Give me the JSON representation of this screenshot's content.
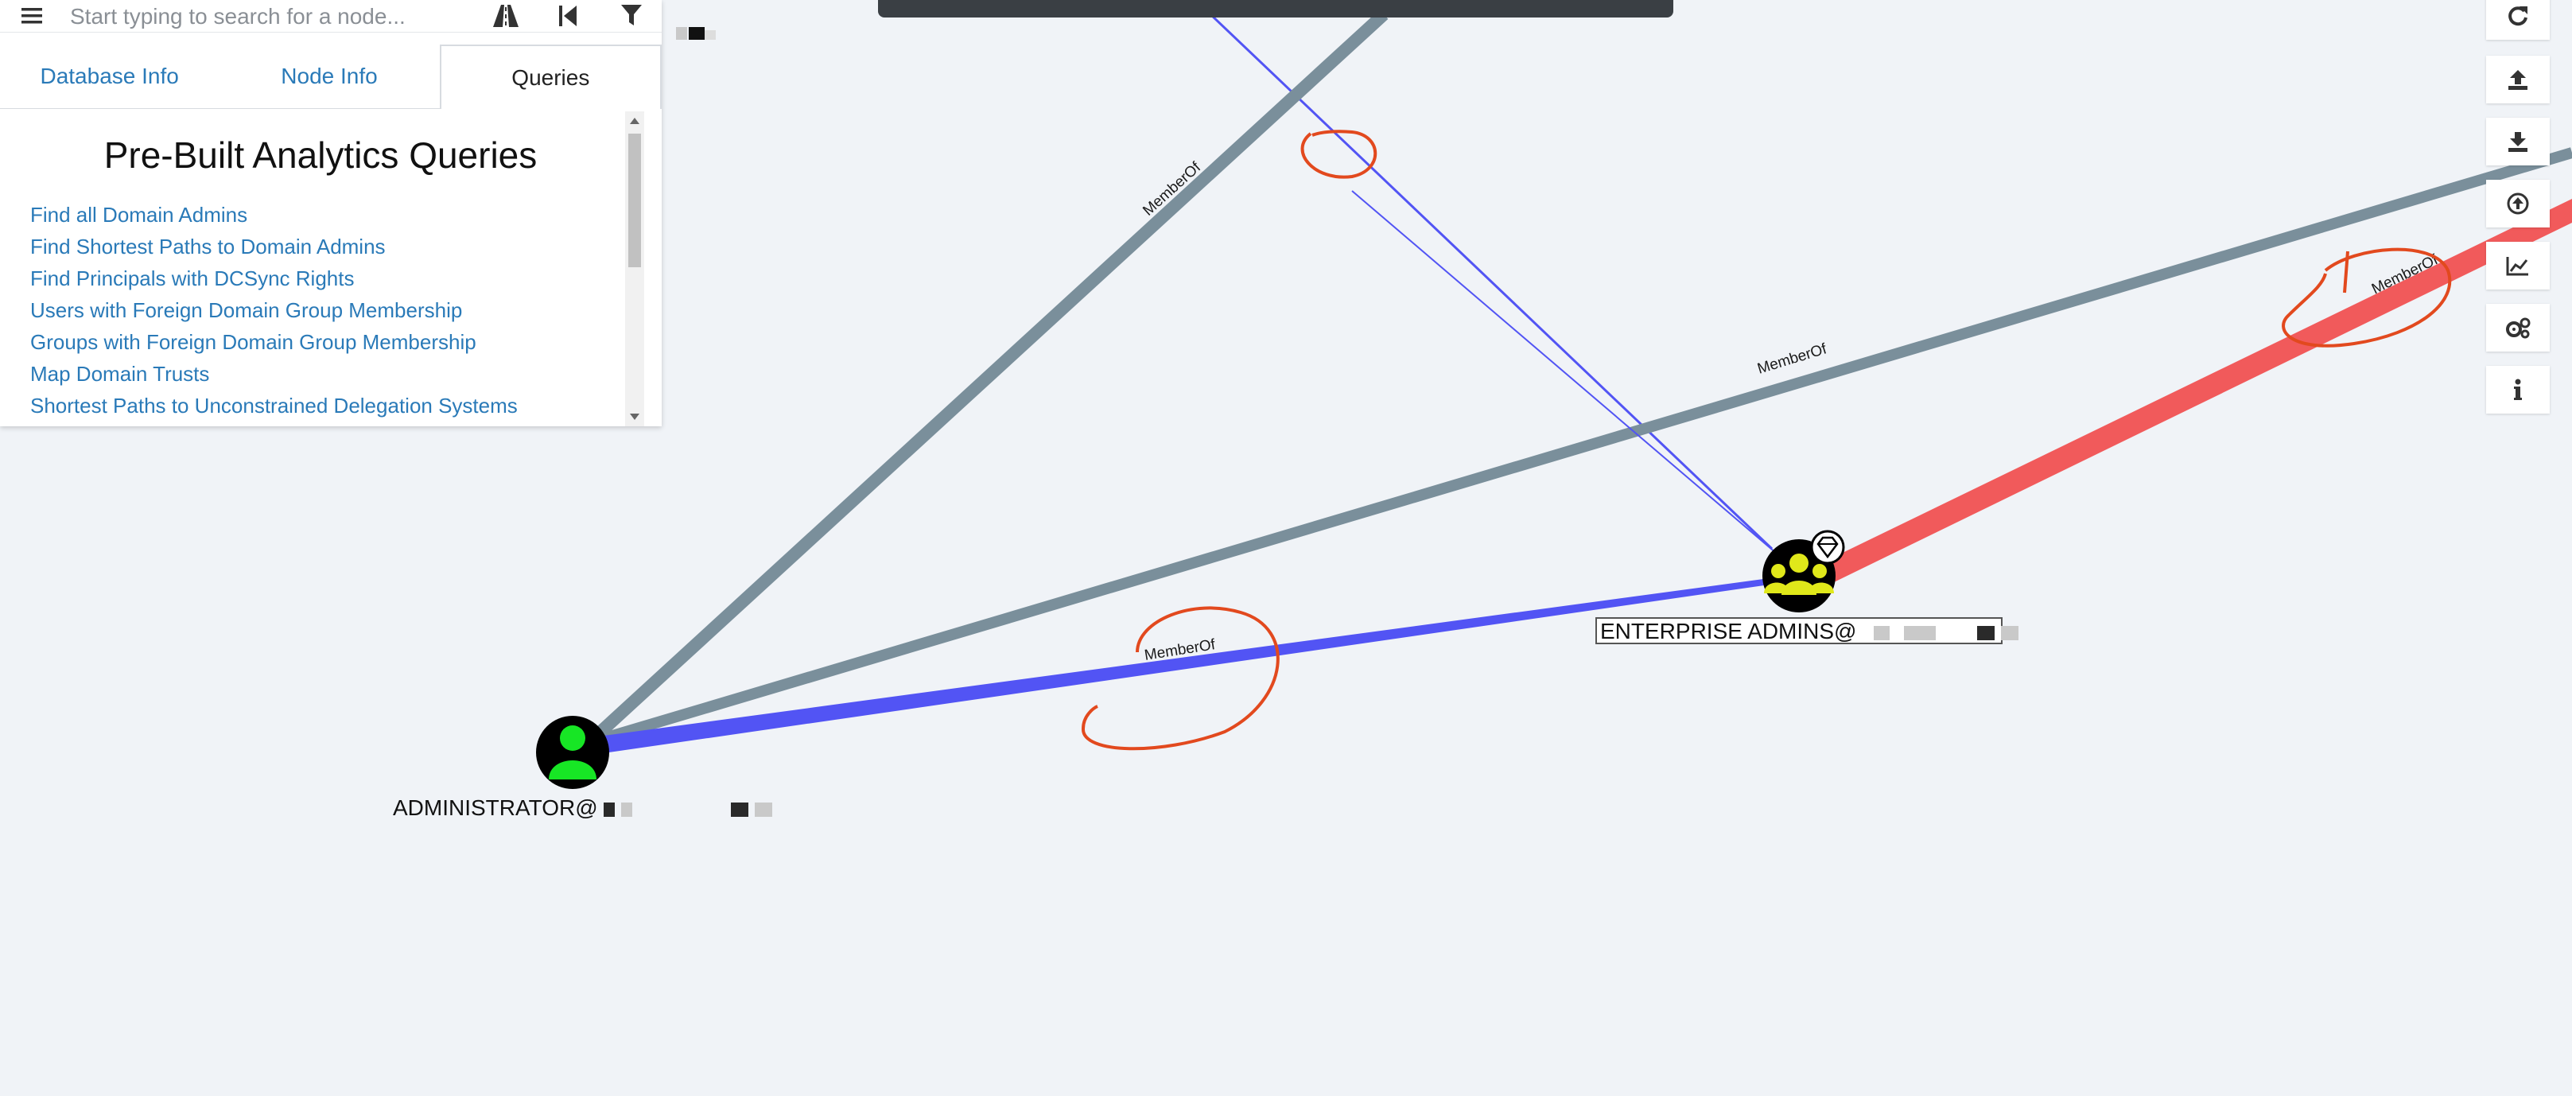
{
  "search": {
    "placeholder": "Start typing to search for a node..."
  },
  "tabs": [
    {
      "label": "Database Info",
      "active": false
    },
    {
      "label": "Node Info",
      "active": false
    },
    {
      "label": "Queries",
      "active": true
    }
  ],
  "queries": {
    "title": "Pre-Built Analytics Queries",
    "items": [
      "Find all Domain Admins",
      "Find Shortest Paths to Domain Admins",
      "Find Principals with DCSync Rights",
      "Users with Foreign Domain Group Membership",
      "Groups with Foreign Domain Group Membership",
      "Map Domain Trusts",
      "Shortest Paths to Unconstrained Delegation Systems"
    ]
  },
  "graph": {
    "edges": [
      {
        "label": "MemberOf"
      },
      {
        "label": "MemberOf"
      },
      {
        "label": "MemberOf"
      },
      {
        "label": "MemberOf"
      }
    ],
    "nodes": [
      {
        "label": "ENTERPRISE ADMINS@",
        "kind": "group"
      },
      {
        "label": "ADMINISTRATOR@",
        "kind": "user"
      }
    ]
  },
  "toolbar": {
    "icons": [
      "refresh-icon",
      "upload-icon",
      "download-icon",
      "import-icon",
      "chart-icon",
      "settings-icon",
      "info-icon"
    ]
  },
  "colors": {
    "edge_blue": "#5254f4",
    "edge_gray": "#7a8f9b",
    "edge_red": "#f15a5b",
    "group_node": "#e0e81a",
    "user_node": "#17e625",
    "annotation": "#e2491e",
    "link": "#2a7ab8"
  }
}
